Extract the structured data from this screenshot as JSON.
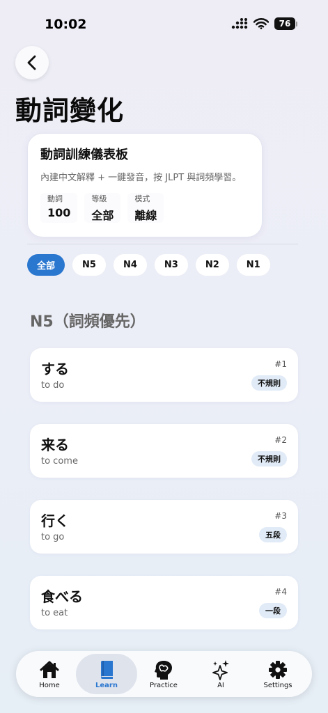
{
  "status_bar": {
    "time": "10:02",
    "battery": "76"
  },
  "header": {
    "title": "動詞變化"
  },
  "dashboard": {
    "title": "動詞訓練儀表板",
    "subtitle": "內建中文解釋 + 一鍵發音，按 JLPT 與詞頻學習。",
    "stats": [
      {
        "label": "動詞",
        "value": "100"
      },
      {
        "label": "等級",
        "value": "全部"
      },
      {
        "label": "模式",
        "value": "離線"
      }
    ]
  },
  "filters": [
    "全部",
    "N5",
    "N4",
    "N3",
    "N2",
    "N1"
  ],
  "selected_filter": "全部",
  "section": {
    "title": "N5（詞頻優先）"
  },
  "verbs": [
    {
      "word": "する",
      "meaning": "to do",
      "rank": "#1",
      "type": "不規則"
    },
    {
      "word": "来る",
      "meaning": "to come",
      "rank": "#2",
      "type": "不規則"
    },
    {
      "word": "行く",
      "meaning": "to go",
      "rank": "#3",
      "type": "五段"
    },
    {
      "word": "食べる",
      "meaning": "to eat",
      "rank": "#4",
      "type": "一段"
    }
  ],
  "tabs": [
    {
      "label": "Home",
      "icon": "home-icon"
    },
    {
      "label": "Learn",
      "icon": "book-icon"
    },
    {
      "label": "Practice",
      "icon": "brain-icon"
    },
    {
      "label": "AI",
      "icon": "sparkles-icon"
    },
    {
      "label": "Settings",
      "icon": "gear-icon"
    }
  ],
  "active_tab": "Learn",
  "colors": {
    "accent": "#2a77d0",
    "badge_bg": "#e1ebf7",
    "active_tab_bg": "#dfe3ec"
  }
}
